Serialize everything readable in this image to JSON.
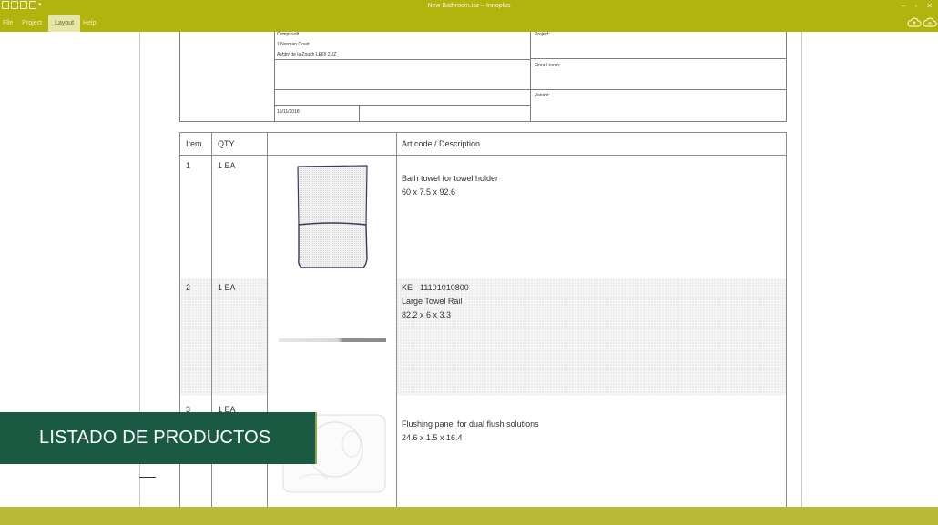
{
  "window": {
    "title": "New Bathroom.isz – Innoplus",
    "controls": {
      "minimize": "–",
      "restore": "▫",
      "close": "✕"
    }
  },
  "menu": {
    "items": [
      {
        "label": "File"
      },
      {
        "label": "Project"
      },
      {
        "label": "Layout",
        "active": true
      },
      {
        "label": "Help"
      }
    ]
  },
  "header_box": {
    "company_line1": "Compusoft",
    "company_line2": "1 Norman Court",
    "company_line3": "Ashby de la Zouch LE65 2UZ",
    "project_label": "Project:",
    "floor_label": "Floor / room:",
    "variant_label": "Variant:",
    "date": "15/11/2018"
  },
  "table": {
    "headers": {
      "item": "Item",
      "qty": "QTY",
      "image": "",
      "description": "Art.code / Description"
    },
    "rows": [
      {
        "item": "1",
        "qty": "1 EA",
        "code": "",
        "name": "Bath towel for towel holder",
        "dims": "60 x 7.5 x 92.6"
      },
      {
        "item": "2",
        "qty": "1 EA",
        "code": "KE - 11101010800",
        "name": "Large Towel Rail",
        "dims": "82.2 x 6 x 3.3"
      },
      {
        "item": "3",
        "qty": "1 EA",
        "code": "",
        "name": "Flushing panel for dual flush solutions",
        "dims": "24.6 x 1.5 x 16.4"
      }
    ]
  },
  "banner": {
    "text": "LISTADO DE PRODUCTOS"
  },
  "colors": {
    "titlebar": "#b3b30e",
    "banner": "#1a5a43",
    "bottom_band": "#b9b93a"
  }
}
